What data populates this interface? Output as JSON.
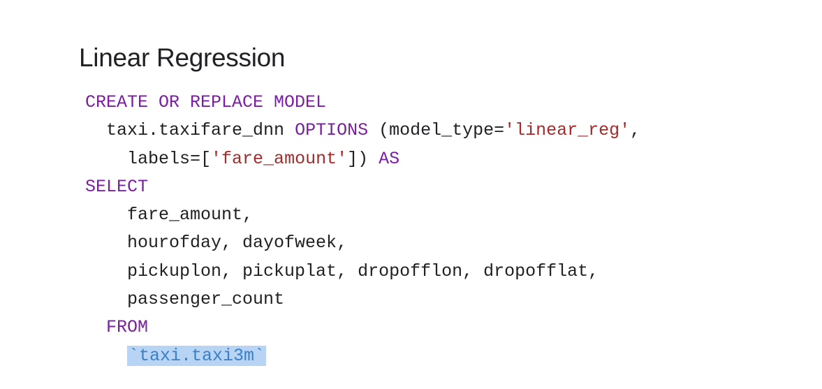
{
  "slide": {
    "title": "Linear Regression"
  },
  "code": {
    "line1": {
      "kw": "CREATE OR REPLACE MODEL"
    },
    "line2": {
      "indent": "  ",
      "t1": "taxi.taxifare_dnn ",
      "kw": "OPTIONS",
      "t2": " (model_type=",
      "str": "'linear_reg'",
      "t3": ","
    },
    "line3": {
      "indent": "    ",
      "t1": "labels=[",
      "str": "'fare_amount'",
      "t2": "]) ",
      "kw": "AS"
    },
    "line4": {
      "kw": "SELECT"
    },
    "line5": {
      "indent": "    ",
      "text": "fare_amount,"
    },
    "line6": {
      "indent": "    ",
      "text": "hourofday, dayofweek,"
    },
    "line7": {
      "indent": "    ",
      "text": "pickuplon, pickuplat, dropofflon, dropofflat,"
    },
    "line8": {
      "indent": "    ",
      "text": "passenger_count"
    },
    "line9": {
      "indent": "  ",
      "kw": "FROM"
    },
    "line10": {
      "indent": "    ",
      "table": "`taxi.taxi3m`"
    }
  },
  "colors": {
    "keyword": "#7b1fa2",
    "string": "#a52a2a",
    "table_text": "#3b7fc4",
    "highlight": "#b8d4f5",
    "text": "#202124",
    "background": "#ffffff"
  }
}
